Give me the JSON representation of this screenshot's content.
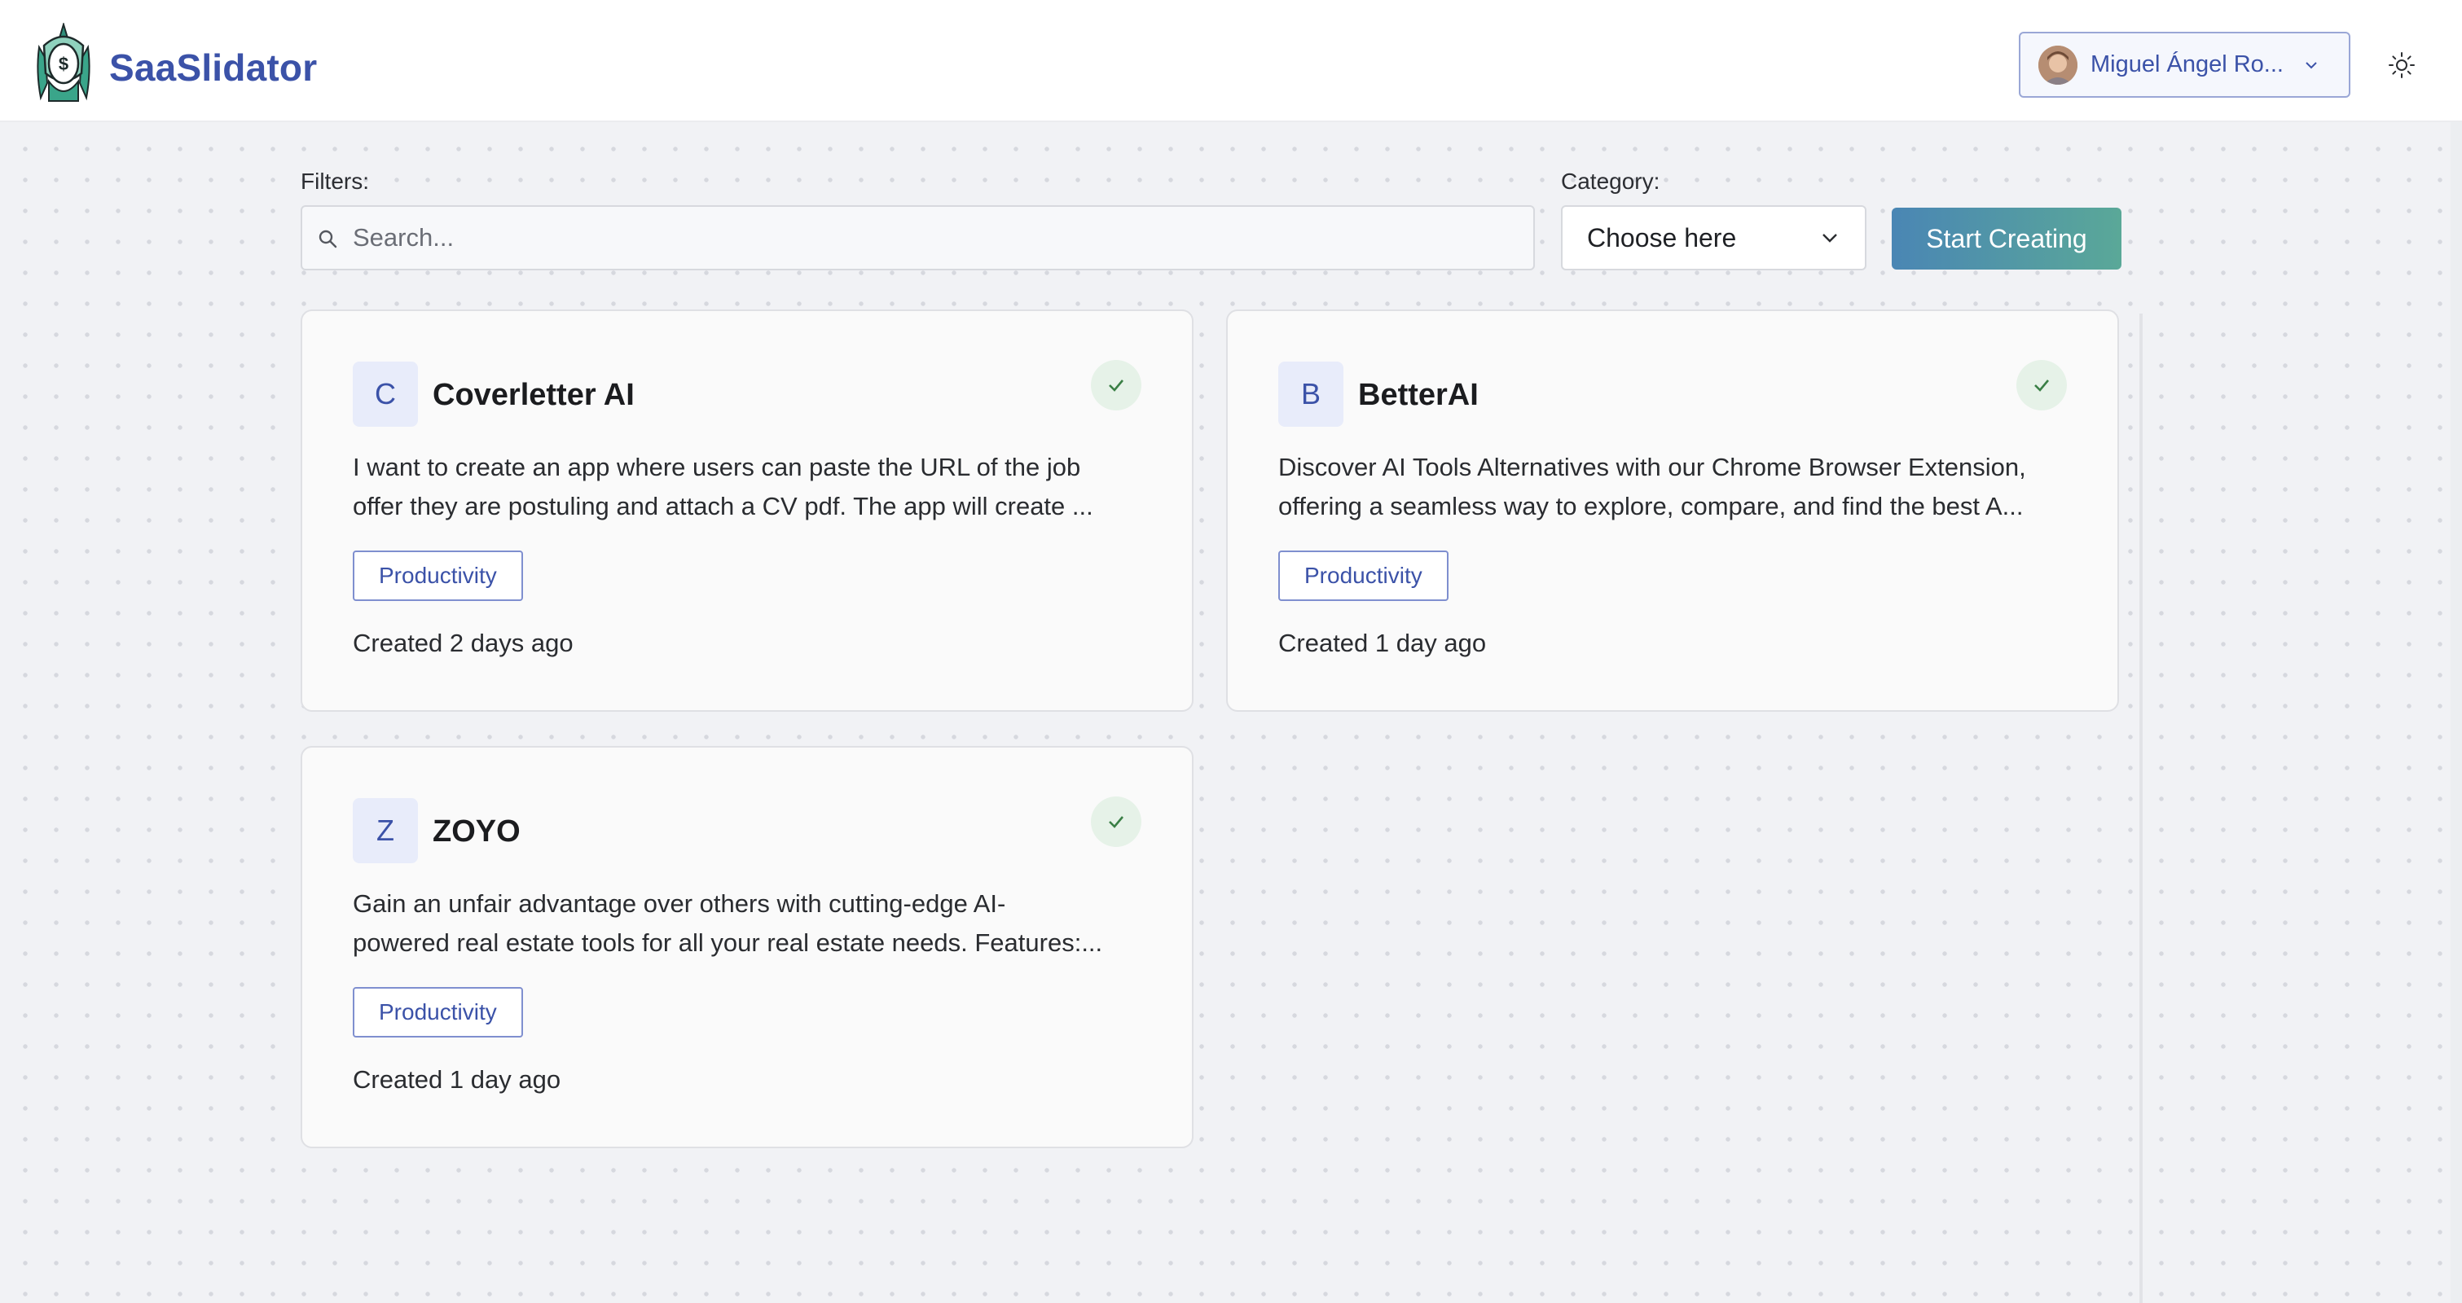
{
  "header": {
    "brand": "SaaSlidator",
    "user": {
      "name": "Miguel Ángel Ro..."
    }
  },
  "filters": {
    "label": "Filters:",
    "search_placeholder": "Search...",
    "category_label": "Category:",
    "category_value": "Choose here",
    "start_button": "Start Creating"
  },
  "colors": {
    "brand": "#3b52a8",
    "accent_gradient_start": "#4a86b4",
    "accent_gradient_end": "#5aa898",
    "check_green": "#3a7f45"
  },
  "cards": [
    {
      "initial": "C",
      "title": "Coverletter AI",
      "desc_line1": "I want to create an app where users can paste the URL of the job",
      "desc_line2": "offer they are postuling and attach a CV pdf. The app will create ...",
      "tag": "Productivity",
      "created": "Created 2 days ago",
      "status_icon": "check-icon"
    },
    {
      "initial": "B",
      "title": "BetterAI",
      "desc_line1": "Discover AI Tools Alternatives with our Chrome Browser Extension,",
      "desc_line2": "offering a seamless way to explore, compare, and find the best A...",
      "tag": "Productivity",
      "created": "Created 1 day ago",
      "status_icon": "check-icon"
    },
    {
      "initial": "Z",
      "title": "ZOYO",
      "desc_line1": "Gain an unfair advantage over others with cutting-edge AI-",
      "desc_line2": "powered real estate tools for all your real estate needs. Features:...",
      "tag": "Productivity",
      "created": "Created 1 day ago",
      "status_icon": "check-icon"
    }
  ]
}
